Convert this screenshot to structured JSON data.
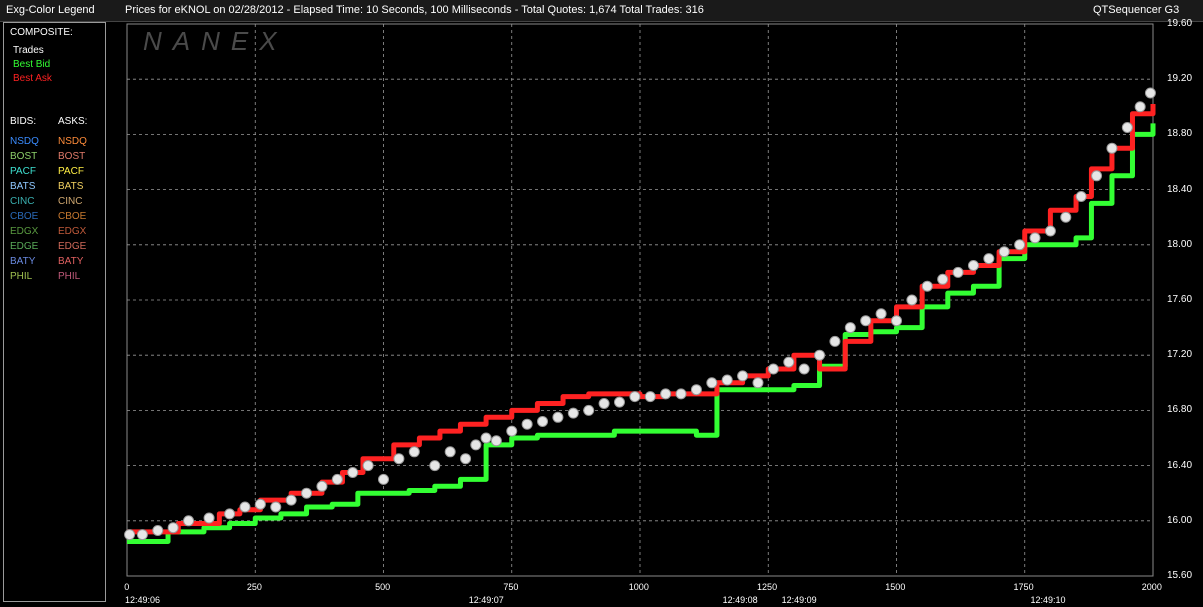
{
  "window": {
    "legend_title": "Exg-Color Legend",
    "chart_title": "Prices for  eKNOL  on  02/28/2012  -  Elapsed Time: 10 Seconds, 100 Milliseconds  -  Total Quotes: 1,674  Total Trades: 316",
    "app_name": "QTSequencer G3"
  },
  "legend": {
    "composite_header": "COMPOSITE:",
    "composite": [
      {
        "label": "Trades",
        "color": "#ffffff"
      },
      {
        "label": "Best Bid",
        "color": "#33ff33"
      },
      {
        "label": "Best Ask",
        "color": "#ff2222"
      }
    ],
    "bids_header": "BIDS:",
    "asks_header": "ASKS:",
    "exchanges": [
      {
        "bid": "NSDQ",
        "ask": "NSDQ",
        "bid_color": "#3a8cff",
        "ask_color": "#ff8c3a"
      },
      {
        "bid": "BOST",
        "ask": "BOST",
        "bid_color": "#8ccf6a",
        "ask_color": "#e07a6a"
      },
      {
        "bid": "PACF",
        "ask": "PACF",
        "bid_color": "#3de0d0",
        "ask_color": "#ffee44"
      },
      {
        "bid": "BATS",
        "ask": "BATS",
        "bid_color": "#8fc8ff",
        "ask_color": "#f2d060"
      },
      {
        "bid": "CINC",
        "ask": "CINC",
        "bid_color": "#3ab0b0",
        "ask_color": "#d0a870"
      },
      {
        "bid": "CBOE",
        "ask": "CBOE",
        "bid_color": "#2a6ab8",
        "ask_color": "#c87a30"
      },
      {
        "bid": "EDGX",
        "ask": "EDGX",
        "bid_color": "#5a9a40",
        "ask_color": "#c05a3a"
      },
      {
        "bid": "EDGE",
        "ask": "EDGE",
        "bid_color": "#5aaa5a",
        "ask_color": "#d06a5a"
      },
      {
        "bid": "BATY",
        "ask": "BATY",
        "bid_color": "#6a8ae0",
        "ask_color": "#e06060"
      },
      {
        "bid": "PHIL",
        "ask": "PHIL",
        "bid_color": "#a0c050",
        "ask_color": "#c05a7a"
      }
    ]
  },
  "chart_data": {
    "type": "line",
    "watermark": "NANEX",
    "xlim": [
      0,
      2000
    ],
    "ylim": [
      15.6,
      19.6
    ],
    "x_ticks": [
      0,
      250,
      500,
      750,
      1000,
      1250,
      1500,
      1750,
      2000
    ],
    "y_ticks": [
      "19.60",
      "19.20",
      "18.80",
      "18.40",
      "18.00",
      "17.60",
      "17.20",
      "16.80",
      "16.40",
      "16.00",
      "15.60"
    ],
    "time_labels": [
      {
        "x": 0,
        "label": "12:49:06"
      },
      {
        "x": 670,
        "label": "12:49:07"
      },
      {
        "x": 1165,
        "label": "12:49:08"
      },
      {
        "x": 1280,
        "label": "12:49:09"
      },
      {
        "x": 1765,
        "label": "12:49:10"
      }
    ],
    "series": [
      {
        "name": "Best Bid",
        "color": "#33ff33",
        "points": [
          [
            0,
            15.85
          ],
          [
            80,
            15.92
          ],
          [
            150,
            15.95
          ],
          [
            200,
            15.98
          ],
          [
            250,
            16.02
          ],
          [
            300,
            16.05
          ],
          [
            350,
            16.1
          ],
          [
            400,
            16.12
          ],
          [
            450,
            16.2
          ],
          [
            500,
            16.2
          ],
          [
            550,
            16.22
          ],
          [
            600,
            16.25
          ],
          [
            650,
            16.3
          ],
          [
            700,
            16.55
          ],
          [
            750,
            16.6
          ],
          [
            800,
            16.62
          ],
          [
            850,
            16.62
          ],
          [
            900,
            16.62
          ],
          [
            950,
            16.65
          ],
          [
            1000,
            16.65
          ],
          [
            1050,
            16.65
          ],
          [
            1100,
            16.65
          ],
          [
            1110,
            16.62
          ],
          [
            1150,
            16.95
          ],
          [
            1200,
            16.95
          ],
          [
            1260,
            16.95
          ],
          [
            1300,
            16.98
          ],
          [
            1350,
            17.12
          ],
          [
            1400,
            17.35
          ],
          [
            1450,
            17.37
          ],
          [
            1500,
            17.4
          ],
          [
            1550,
            17.55
          ],
          [
            1600,
            17.65
          ],
          [
            1650,
            17.7
          ],
          [
            1700,
            17.9
          ],
          [
            1750,
            18.0
          ],
          [
            1800,
            18.0
          ],
          [
            1850,
            18.05
          ],
          [
            1880,
            18.3
          ],
          [
            1920,
            18.5
          ],
          [
            1960,
            18.8
          ],
          [
            2000,
            18.88
          ]
        ]
      },
      {
        "name": "Best Ask",
        "color": "#ff2222",
        "points": [
          [
            0,
            15.92
          ],
          [
            100,
            15.98
          ],
          [
            180,
            16.05
          ],
          [
            220,
            16.08
          ],
          [
            260,
            16.15
          ],
          [
            320,
            16.2
          ],
          [
            380,
            16.28
          ],
          [
            420,
            16.35
          ],
          [
            460,
            16.45
          ],
          [
            520,
            16.55
          ],
          [
            570,
            16.6
          ],
          [
            610,
            16.65
          ],
          [
            650,
            16.7
          ],
          [
            700,
            16.75
          ],
          [
            750,
            16.8
          ],
          [
            800,
            16.85
          ],
          [
            850,
            16.9
          ],
          [
            900,
            16.92
          ],
          [
            950,
            16.92
          ],
          [
            1000,
            16.9
          ],
          [
            1050,
            16.92
          ],
          [
            1100,
            16.92
          ],
          [
            1150,
            17.0
          ],
          [
            1200,
            17.05
          ],
          [
            1250,
            17.1
          ],
          [
            1300,
            17.2
          ],
          [
            1350,
            17.1
          ],
          [
            1400,
            17.3
          ],
          [
            1450,
            17.45
          ],
          [
            1500,
            17.55
          ],
          [
            1550,
            17.7
          ],
          [
            1600,
            17.8
          ],
          [
            1650,
            17.85
          ],
          [
            1700,
            17.95
          ],
          [
            1750,
            18.1
          ],
          [
            1800,
            18.25
          ],
          [
            1850,
            18.35
          ],
          [
            1880,
            18.55
          ],
          [
            1920,
            18.7
          ],
          [
            1960,
            18.95
          ],
          [
            2000,
            19.02
          ]
        ]
      }
    ],
    "trades": [
      [
        5,
        15.9
      ],
      [
        30,
        15.9
      ],
      [
        60,
        15.93
      ],
      [
        90,
        15.95
      ],
      [
        120,
        16.0
      ],
      [
        160,
        16.02
      ],
      [
        200,
        16.05
      ],
      [
        230,
        16.1
      ],
      [
        260,
        16.12
      ],
      [
        290,
        16.1
      ],
      [
        320,
        16.15
      ],
      [
        350,
        16.2
      ],
      [
        380,
        16.25
      ],
      [
        410,
        16.3
      ],
      [
        440,
        16.35
      ],
      [
        470,
        16.4
      ],
      [
        500,
        16.3
      ],
      [
        530,
        16.45
      ],
      [
        560,
        16.5
      ],
      [
        600,
        16.4
      ],
      [
        630,
        16.5
      ],
      [
        660,
        16.45
      ],
      [
        680,
        16.55
      ],
      [
        700,
        16.6
      ],
      [
        720,
        16.58
      ],
      [
        750,
        16.65
      ],
      [
        780,
        16.7
      ],
      [
        810,
        16.72
      ],
      [
        840,
        16.75
      ],
      [
        870,
        16.78
      ],
      [
        900,
        16.8
      ],
      [
        930,
        16.85
      ],
      [
        960,
        16.86
      ],
      [
        990,
        16.9
      ],
      [
        1020,
        16.9
      ],
      [
        1050,
        16.92
      ],
      [
        1080,
        16.92
      ],
      [
        1110,
        16.95
      ],
      [
        1140,
        17.0
      ],
      [
        1170,
        17.02
      ],
      [
        1200,
        17.05
      ],
      [
        1230,
        17.0
      ],
      [
        1260,
        17.1
      ],
      [
        1290,
        17.15
      ],
      [
        1320,
        17.1
      ],
      [
        1350,
        17.2
      ],
      [
        1380,
        17.3
      ],
      [
        1410,
        17.4
      ],
      [
        1440,
        17.45
      ],
      [
        1470,
        17.5
      ],
      [
        1500,
        17.45
      ],
      [
        1530,
        17.6
      ],
      [
        1560,
        17.7
      ],
      [
        1590,
        17.75
      ],
      [
        1620,
        17.8
      ],
      [
        1650,
        17.85
      ],
      [
        1680,
        17.9
      ],
      [
        1710,
        17.95
      ],
      [
        1740,
        18.0
      ],
      [
        1770,
        18.05
      ],
      [
        1800,
        18.1
      ],
      [
        1830,
        18.2
      ],
      [
        1860,
        18.35
      ],
      [
        1890,
        18.5
      ],
      [
        1920,
        18.7
      ],
      [
        1950,
        18.85
      ],
      [
        1975,
        19.0
      ],
      [
        1995,
        19.1
      ]
    ]
  }
}
